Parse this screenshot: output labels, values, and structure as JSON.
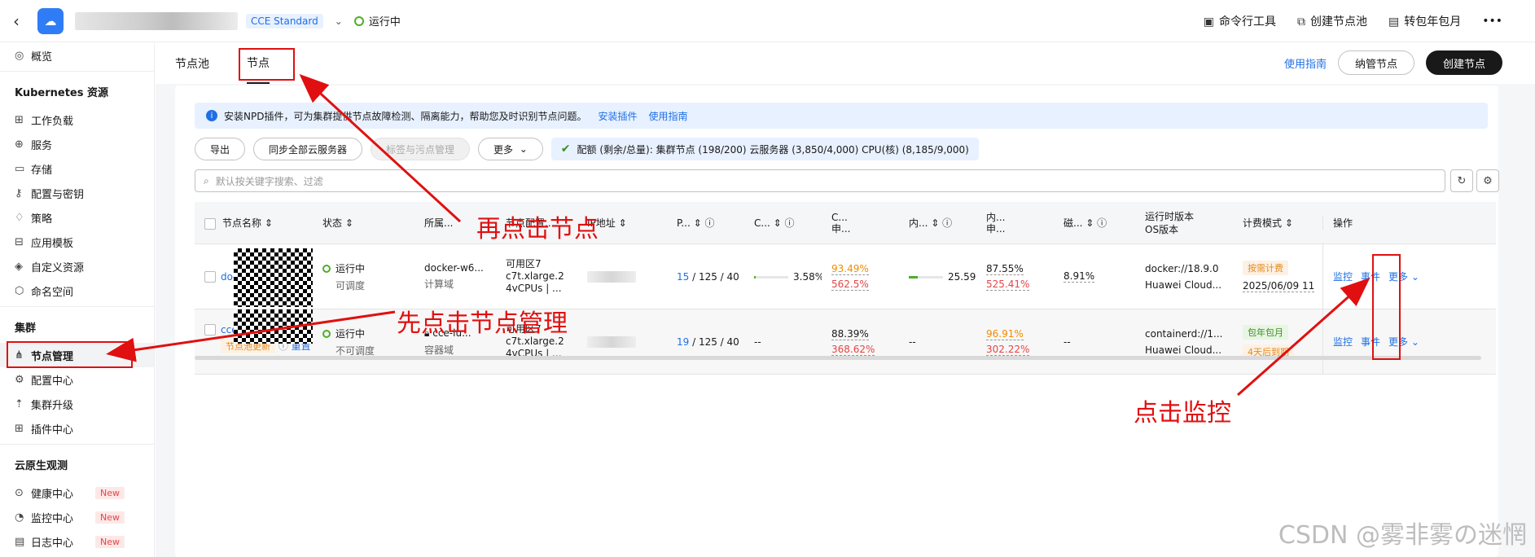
{
  "topbar": {
    "back_icon": "chevron-left-icon",
    "edition": "CCE Standard",
    "status": "运行中",
    "actions": [
      {
        "icon": "terminal-icon",
        "label": "命令行工具"
      },
      {
        "icon": "node-pool-icon",
        "label": "创建节点池"
      },
      {
        "icon": "billing-icon",
        "label": "转包年包月"
      }
    ],
    "more": "•••"
  },
  "sidebar": {
    "overview": "概览",
    "k8s_title": "Kubernetes 资源",
    "k8s_items": [
      "工作负载",
      "服务",
      "存储",
      "配置与密钥",
      "策略",
      "应用模板",
      "自定义资源",
      "命名空间"
    ],
    "cluster_title": "集群",
    "cluster_items": [
      "节点管理",
      "配置中心",
      "集群升级",
      "插件中心"
    ],
    "obs_title": "云原生观测",
    "obs_items": [
      {
        "label": "健康中心",
        "badge": "New"
      },
      {
        "label": "监控中心",
        "badge": "New"
      },
      {
        "label": "日志中心",
        "badge": "New"
      }
    ]
  },
  "tabs": {
    "items": [
      "节点池",
      "节点"
    ],
    "guide": "使用指南",
    "manage_btn": "纳管节点",
    "create_btn": "创建节点"
  },
  "notice": {
    "text": "安装NPD插件，可为集群提供节点故障检测、隔离能力，帮助您及时识别节点问题。",
    "link1": "安装插件",
    "link2": "使用指南"
  },
  "toolbar": {
    "export": "导出",
    "sync": "同步全部云服务器",
    "labels": "标签与污点管理",
    "more": "更多",
    "quota": "配额 (剩余/总量):  集群节点 (198/200) 云服务器 (3,850/4,000) CPU(核) (8,185/9,000)"
  },
  "search": {
    "placeholder": "默认按关键字搜索、过滤"
  },
  "table": {
    "headers": [
      "节点名称",
      "状态",
      "所属...",
      "节点配置...",
      "IP地址",
      "P...",
      "C...",
      "C...\n申...",
      "内...",
      "内...\n申...",
      "磁...",
      "运行时版本\nOS版本",
      "计费模式",
      "操作"
    ],
    "rows": [
      {
        "name": "doc",
        "status": "运行中",
        "sub_status": "可调度",
        "pool": "docker-w6...",
        "pool_sub": "计算域",
        "spec1": "可用区7",
        "spec2": "c7t.xlarge.2",
        "spec3": "4vCPUs | ...",
        "pods_used": "15",
        "pods_rest": " / 125 / 40",
        "cpu": "3.58%",
        "cpu_fill": 0.04,
        "cpu_req": "93.49%",
        "cpu_lim": "562.5%",
        "mem": "25.59%",
        "mem_fill": 0.26,
        "mem_req": "87.55%",
        "mem_lim": "525.41%",
        "disk": "8.91%",
        "runtime": "docker://18.9.0",
        "os": "Huawei Cloud...",
        "billing": "按需计费",
        "billing_sub": "2025/06/09 11",
        "ops": [
          "监控",
          "事件",
          "更多"
        ]
      },
      {
        "name": "cce",
        "tag": "节点池更新",
        "reset": "重置",
        "status": "运行中",
        "sub_status": "不可调度",
        "pool": "cce-lu...",
        "pool_sub": "容器域",
        "spec1": "可用区7",
        "spec2": "c7t.xlarge.2",
        "spec3": "4vCPUs | ...",
        "pods_used": "19",
        "pods_rest": " / 125 / 40",
        "cpu": "--",
        "cpu_req": "88.39%",
        "cpu_lim": "368.62%",
        "mem": "--",
        "mem_req": "96.91%",
        "mem_lim": "302.22%",
        "disk": "--",
        "runtime": "containerd://1...",
        "os": "Huawei Cloud...",
        "billing": "包年包月",
        "billing_sub": "4天后到期",
        "ops": [
          "监控",
          "事件",
          "更多"
        ]
      }
    ]
  },
  "annotations": {
    "a1": "再点击节点",
    "a2": "先点击节点管理",
    "a3": "点击监控"
  },
  "watermark": "CSDN @雾非雾の迷惘",
  "colors": {
    "accent": "#1f6fe5",
    "annotation": "#e01010",
    "running": "#4fae28"
  }
}
